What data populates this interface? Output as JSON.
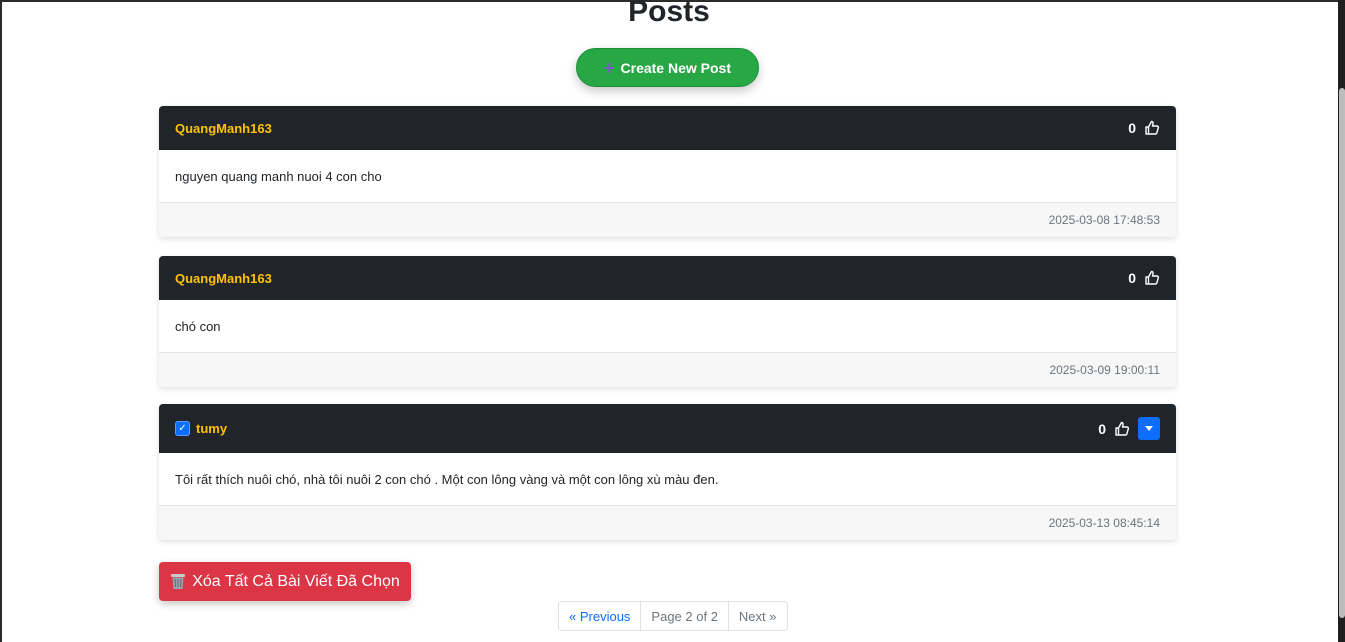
{
  "page": {
    "title": "Posts"
  },
  "toolbar": {
    "create_label": "Create New Post",
    "create_icon": "plus-icon"
  },
  "posts": [
    {
      "author": "QuangManh163",
      "likes": "0",
      "content": "nguyen quang manh nuoi 4 con cho",
      "timestamp": "2025-03-08 17:48:53",
      "selected": false
    },
    {
      "author": "QuangManh163",
      "likes": "0",
      "content": "chó con",
      "timestamp": "2025-03-09 19:00:11",
      "selected": false
    },
    {
      "author": "tumy",
      "likes": "0",
      "content": "Tôi rất thích nuôi chó, nhà tôi nuôi 2 con chó . Một con lông vàng và một con lông xù màu đen.",
      "timestamp": "2025-03-13 08:45:14",
      "selected": true
    }
  ],
  "actions": {
    "delete_selected_label": "Xóa Tất Cả Bài Viết Đã Chọn",
    "delete_icon": "trash-icon"
  },
  "pagination": {
    "previous_label": "« Previous",
    "page_label": "Page 2 of 2",
    "next_label": "Next »"
  },
  "colors": {
    "header_bg": "#212529",
    "author": "#ffc107",
    "create_button": "#28a745",
    "delete_button": "#dc3545",
    "link": "#0d6efd"
  }
}
